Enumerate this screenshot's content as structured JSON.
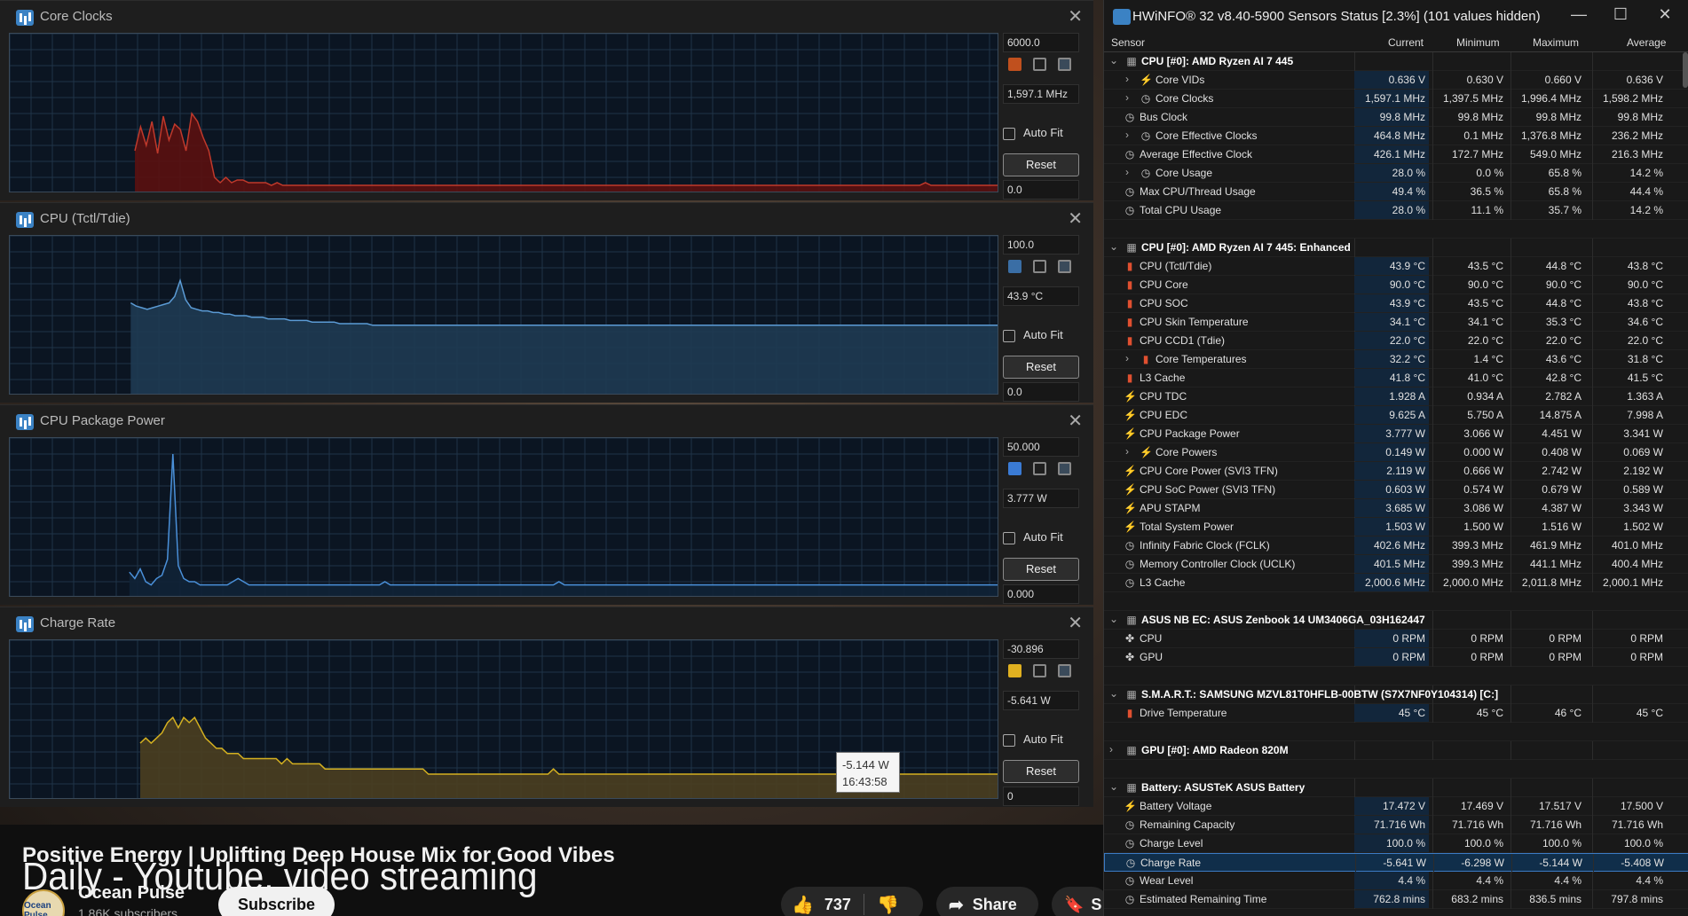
{
  "youtube": {
    "title_line1": "Positive Energy | Uplifting Deep House Mix for Good Vibes",
    "title_overlay": "Daily - Youtube, video streaming",
    "channel": "Ocean Pulse",
    "subscribers": "1.86K subscribers",
    "avatar_text": "Ocean Pulse",
    "subscribe_label": "Subscribe",
    "likes": "737",
    "share_label": "Share",
    "save_label": "S"
  },
  "graphs": [
    {
      "title": "Core Clocks",
      "max": "6000.0",
      "current": "1,597.1 MHz",
      "min": "0.0",
      "autofit": "Auto Fit",
      "reset": "Reset",
      "color": "#c0392b",
      "fill": "#5a1010",
      "swatch": "#c0501e",
      "series": [
        0,
        0,
        0,
        0,
        0,
        0,
        0,
        0,
        0,
        0,
        0,
        0,
        0,
        0,
        0,
        0,
        0,
        0,
        0,
        0,
        0,
        0,
        1600,
        2500,
        1800,
        2700,
        1500,
        2900,
        2000,
        2600,
        2400,
        1600,
        3000,
        2700,
        2100,
        1600,
        600,
        400,
        600,
        400,
        500,
        500,
        400,
        400,
        400,
        400,
        300,
        400,
        300,
        300,
        300,
        300,
        300,
        300,
        300,
        300,
        300,
        300,
        300,
        300,
        300,
        300,
        300,
        300,
        300,
        300,
        300,
        300,
        300,
        300,
        300,
        300,
        300,
        300,
        300,
        300,
        300,
        300,
        300,
        300,
        300,
        300,
        300,
        300,
        300,
        300,
        300,
        300,
        300,
        300,
        300,
        300,
        300,
        300,
        300,
        300,
        300,
        300,
        300,
        300,
        300,
        300,
        300,
        300,
        300,
        300,
        300,
        300,
        300,
        300,
        300,
        300,
        300,
        300,
        300,
        300,
        300,
        300,
        300,
        300,
        300,
        300,
        300,
        300,
        300,
        300,
        300,
        300,
        300,
        300,
        300,
        300,
        300,
        300,
        300,
        300,
        300,
        300,
        300,
        300,
        300,
        300,
        300,
        300,
        300,
        300,
        300,
        300,
        300,
        300,
        300,
        300,
        300,
        300,
        300,
        300,
        300,
        300,
        300,
        300,
        300,
        400,
        300,
        300,
        300,
        300,
        300,
        300,
        300,
        300,
        300,
        300,
        300,
        300,
        300
      ]
    },
    {
      "title": "CPU (Tctl/Tdie)",
      "max": "100.0",
      "current": "43.9 °C",
      "min": "0.0",
      "autofit": "Auto Fit",
      "reset": "Reset",
      "color": "#5b9bd5",
      "fill": "#1e3a52",
      "swatch": "#3a6ea5",
      "series": [
        0,
        0,
        0,
        0,
        0,
        0,
        0,
        0,
        0,
        0,
        0,
        0,
        0,
        0,
        0,
        0,
        0,
        0,
        0,
        0,
        0,
        0,
        58,
        56,
        55,
        54,
        55,
        56,
        57,
        58,
        62,
        72,
        60,
        55,
        54,
        53,
        53,
        52,
        52,
        51,
        51,
        50,
        50,
        50,
        49,
        49,
        49,
        48,
        48,
        48,
        48,
        47,
        47,
        47,
        47,
        46,
        46,
        46,
        46,
        46,
        45,
        45,
        45,
        45,
        45,
        45,
        44,
        44,
        44,
        44,
        44,
        44,
        44,
        44,
        44,
        44,
        44,
        44,
        44,
        44,
        44,
        44,
        44,
        44,
        44,
        44,
        44,
        44,
        44,
        44,
        44,
        44,
        44,
        44,
        44,
        44,
        44,
        44,
        44,
        44,
        44,
        44,
        44,
        44,
        44,
        44,
        44,
        44,
        44,
        44,
        44,
        44,
        44,
        44,
        44,
        44,
        44,
        44,
        44,
        44,
        44,
        44,
        44,
        44,
        44,
        44,
        44,
        44,
        44,
        44,
        44,
        44,
        44,
        44,
        44,
        44,
        44,
        44,
        44,
        44,
        44,
        44,
        44,
        44,
        44,
        44,
        44,
        44,
        44,
        44,
        44,
        44,
        44,
        44,
        44,
        44,
        44,
        44,
        44,
        44,
        44,
        44,
        44,
        44,
        44,
        44,
        44,
        44,
        44,
        44,
        44,
        44,
        44,
        44,
        44,
        44,
        44,
        44,
        44,
        44,
        44
      ]
    },
    {
      "title": "CPU Package Power",
      "max": "50.000",
      "current": "3.777 W",
      "min": "0.000",
      "autofit": "Auto Fit",
      "reset": "Reset",
      "color": "#4a90d9",
      "fill": "#0f2236",
      "swatch": "#3a7bd5",
      "series": [
        0,
        0,
        0,
        0,
        0,
        0,
        0,
        0,
        0,
        0,
        0,
        0,
        0,
        0,
        0,
        0,
        0,
        0,
        0,
        0,
        0,
        0,
        8,
        6,
        9,
        5,
        4,
        6,
        7,
        12,
        45,
        10,
        6,
        5,
        5,
        4,
        4,
        4,
        4,
        4,
        4,
        5,
        6,
        5,
        4,
        4,
        4,
        4,
        4,
        4,
        4,
        4,
        4,
        4,
        4,
        4,
        4,
        4,
        4,
        4,
        4,
        4,
        4,
        4,
        4,
        4,
        4,
        4,
        4,
        5,
        4,
        4,
        4,
        4,
        4,
        4,
        4,
        4,
        4,
        4,
        4,
        4,
        4,
        4,
        4,
        4,
        4,
        4,
        4,
        4,
        4,
        4,
        4,
        4,
        4,
        4,
        4,
        4,
        4,
        4,
        4,
        5,
        4,
        4,
        4,
        4,
        4,
        4,
        4,
        4,
        4,
        4,
        4,
        4,
        4,
        4,
        4,
        4,
        4,
        4,
        4,
        4,
        4,
        4,
        4,
        4,
        4,
        4,
        4,
        4,
        4,
        4,
        4,
        4,
        4,
        4,
        4,
        4,
        4,
        4,
        4,
        4,
        4,
        4,
        4,
        4,
        4,
        4,
        4,
        4,
        4,
        4,
        4,
        4,
        4,
        4,
        4,
        4,
        4,
        4,
        4,
        4,
        4,
        4,
        4,
        4,
        4,
        4,
        4,
        4,
        4,
        4,
        4,
        4,
        4,
        4,
        4,
        4,
        4,
        4,
        4,
        4,
        4
      ]
    },
    {
      "title": "Charge Rate",
      "max": "-30.896",
      "current": "-5.641 W",
      "min": "0",
      "autofit": "Auto Fit",
      "reset": "Reset",
      "color": "#d4b020",
      "fill": "#4a3e20",
      "swatch": "#e0b020",
      "series": [
        0,
        0,
        0,
        0,
        0,
        0,
        0,
        0,
        0,
        0,
        0,
        0,
        0,
        0,
        0,
        0,
        0,
        0,
        0,
        0,
        0,
        0,
        0,
        0,
        11,
        12,
        11,
        12,
        13,
        15,
        16,
        14,
        16,
        15,
        16,
        14,
        12,
        11,
        10,
        10,
        9,
        9,
        9,
        8,
        8,
        8,
        8,
        8,
        8,
        8,
        7,
        8,
        7,
        7,
        7,
        7,
        7,
        7,
        6,
        6,
        6,
        6,
        6,
        6,
        6,
        6,
        6,
        6,
        6,
        6,
        6,
        6,
        6,
        6,
        6,
        6,
        6,
        5,
        5,
        5,
        5,
        5,
        5,
        5,
        5,
        5,
        5,
        5,
        5,
        5,
        5,
        5,
        5,
        5,
        5,
        5,
        5,
        5,
        5,
        5,
        6,
        5,
        5,
        5,
        5,
        5,
        5,
        5,
        5,
        5,
        5,
        5,
        5,
        5,
        5,
        5,
        5,
        5,
        5,
        5,
        5,
        5,
        5,
        5,
        5,
        5,
        5,
        5,
        5,
        5,
        5,
        5,
        5,
        5,
        5,
        5,
        5,
        5,
        5,
        5,
        5,
        5,
        5,
        5,
        5,
        5,
        5,
        5,
        5,
        5,
        5,
        5,
        5,
        5,
        5,
        5,
        5,
        5,
        5,
        5,
        5,
        5,
        5,
        5,
        5,
        5,
        5,
        5,
        5,
        5,
        5,
        5,
        5,
        5,
        5,
        5,
        5,
        5,
        5,
        5,
        5,
        5,
        5
      ]
    }
  ],
  "tooltip": {
    "value": "-5.144 W",
    "time": "16:43:58"
  },
  "hwinfo": {
    "title": "HWiNFO® 32 v8.40-5900 Sensors Status [2.3%] (101 values hidden)",
    "controls": {
      "minimize": "—",
      "maximize": "☐",
      "close": "✕"
    },
    "headers": [
      "Sensor",
      "Current",
      "Minimum",
      "Maximum",
      "Average"
    ],
    "rows": [
      {
        "type": "sec",
        "name": "CPU [#0]: AMD Ryzen AI 7 445"
      },
      {
        "name": "Core VIDs",
        "icon": "bolt",
        "sub": true,
        "cur": "0.636 V",
        "min": "0.630 V",
        "max": "0.660 V",
        "avg": "0.636 V"
      },
      {
        "name": "Core Clocks",
        "icon": "clock",
        "sub": true,
        "cur": "1,597.1 MHz",
        "min": "1,397.5 MHz",
        "max": "1,996.4 MHz",
        "avg": "1,598.2 MHz"
      },
      {
        "name": "Bus Clock",
        "icon": "clock",
        "cur": "99.8 MHz",
        "min": "99.8 MHz",
        "max": "99.8 MHz",
        "avg": "99.8 MHz"
      },
      {
        "name": "Core Effective Clocks",
        "icon": "clock",
        "sub": true,
        "cur": "464.8 MHz",
        "min": "0.1 MHz",
        "max": "1,376.8 MHz",
        "avg": "236.2 MHz"
      },
      {
        "name": "Average Effective Clock",
        "icon": "clock",
        "cur": "426.1 MHz",
        "min": "172.7 MHz",
        "max": "549.0 MHz",
        "avg": "216.3 MHz"
      },
      {
        "name": "Core Usage",
        "icon": "clock",
        "sub": true,
        "cur": "28.0 %",
        "min": "0.0 %",
        "max": "65.8 %",
        "avg": "14.2 %"
      },
      {
        "name": "Max CPU/Thread Usage",
        "icon": "clock",
        "cur": "49.4 %",
        "min": "36.5 %",
        "max": "65.8 %",
        "avg": "44.4 %"
      },
      {
        "name": "Total CPU Usage",
        "icon": "clock",
        "cur": "28.0 %",
        "min": "11.1 %",
        "max": "35.7 %",
        "avg": "14.2 %"
      },
      {
        "type": "blank"
      },
      {
        "type": "sec",
        "name": "CPU [#0]: AMD Ryzen AI 7 445: Enhanced"
      },
      {
        "name": "CPU (Tctl/Tdie)",
        "icon": "temp",
        "cur": "43.9 °C",
        "min": "43.5 °C",
        "max": "44.8 °C",
        "avg": "43.8 °C"
      },
      {
        "name": "CPU Core",
        "icon": "temp",
        "cur": "90.0 °C",
        "min": "90.0 °C",
        "max": "90.0 °C",
        "avg": "90.0 °C"
      },
      {
        "name": "CPU SOC",
        "icon": "temp",
        "cur": "43.9 °C",
        "min": "43.5 °C",
        "max": "44.8 °C",
        "avg": "43.8 °C"
      },
      {
        "name": "CPU Skin Temperature",
        "icon": "temp",
        "cur": "34.1 °C",
        "min": "34.1 °C",
        "max": "35.3 °C",
        "avg": "34.6 °C"
      },
      {
        "name": "CPU CCD1 (Tdie)",
        "icon": "temp",
        "cur": "22.0 °C",
        "min": "22.0 °C",
        "max": "22.0 °C",
        "avg": "22.0 °C"
      },
      {
        "name": "Core Temperatures",
        "icon": "temp",
        "sub": true,
        "cur": "32.2 °C",
        "min": "1.4 °C",
        "max": "43.6 °C",
        "avg": "31.8 °C"
      },
      {
        "name": "L3 Cache",
        "icon": "temp",
        "cur": "41.8 °C",
        "min": "41.0 °C",
        "max": "42.8 °C",
        "avg": "41.5 °C"
      },
      {
        "name": "CPU TDC",
        "icon": "bolt",
        "cur": "1.928 A",
        "min": "0.934 A",
        "max": "2.782 A",
        "avg": "1.363 A"
      },
      {
        "name": "CPU EDC",
        "icon": "bolt",
        "cur": "9.625 A",
        "min": "5.750 A",
        "max": "14.875 A",
        "avg": "7.998 A"
      },
      {
        "name": "CPU Package Power",
        "icon": "bolt",
        "cur": "3.777 W",
        "min": "3.066 W",
        "max": "4.451 W",
        "avg": "3.341 W"
      },
      {
        "name": "Core Powers",
        "icon": "bolt",
        "sub": true,
        "cur": "0.149 W",
        "min": "0.000 W",
        "max": "0.408 W",
        "avg": "0.069 W"
      },
      {
        "name": "CPU Core Power (SVI3 TFN)",
        "icon": "bolt",
        "cur": "2.119 W",
        "min": "0.666 W",
        "max": "2.742 W",
        "avg": "2.192 W"
      },
      {
        "name": "CPU SoC Power (SVI3 TFN)",
        "icon": "bolt",
        "cur": "0.603 W",
        "min": "0.574 W",
        "max": "0.679 W",
        "avg": "0.589 W"
      },
      {
        "name": "APU STAPM",
        "icon": "bolt",
        "cur": "3.685 W",
        "min": "3.086 W",
        "max": "4.387 W",
        "avg": "3.343 W"
      },
      {
        "name": "Total System Power",
        "icon": "bolt",
        "cur": "1.503 W",
        "min": "1.500 W",
        "max": "1.516 W",
        "avg": "1.502 W"
      },
      {
        "name": "Infinity Fabric Clock (FCLK)",
        "icon": "clock",
        "cur": "402.6 MHz",
        "min": "399.3 MHz",
        "max": "461.9 MHz",
        "avg": "401.0 MHz"
      },
      {
        "name": "Memory Controller Clock (UCLK)",
        "icon": "clock",
        "cur": "401.5 MHz",
        "min": "399.3 MHz",
        "max": "441.1 MHz",
        "avg": "400.4 MHz"
      },
      {
        "name": "L3 Cache",
        "icon": "clock",
        "cur": "2,000.6 MHz",
        "min": "2,000.0 MHz",
        "max": "2,011.8 MHz",
        "avg": "2,000.1 MHz"
      },
      {
        "type": "blank"
      },
      {
        "type": "sec",
        "name": "ASUS NB EC: ASUS Zenbook 14 UM3406GA_03H162447"
      },
      {
        "name": "CPU",
        "icon": "fan",
        "cur": "0 RPM",
        "min": "0 RPM",
        "max": "0 RPM",
        "avg": "0 RPM"
      },
      {
        "name": "GPU",
        "icon": "fan",
        "cur": "0 RPM",
        "min": "0 RPM",
        "max": "0 RPM",
        "avg": "0 RPM"
      },
      {
        "type": "blank"
      },
      {
        "type": "sec",
        "name": "S.M.A.R.T.: SAMSUNG MZVL81T0HFLB-00BTW (S7X7NF0Y104314) [C:]"
      },
      {
        "name": "Drive Temperature",
        "icon": "temp",
        "cur": "45 °C",
        "min": "45 °C",
        "max": "46 °C",
        "avg": "45 °C"
      },
      {
        "type": "blank"
      },
      {
        "type": "sec",
        "collapsed": true,
        "name": "GPU [#0]: AMD Radeon 820M"
      },
      {
        "type": "blank"
      },
      {
        "type": "sec",
        "name": "Battery: ASUSTeK ASUS Battery"
      },
      {
        "name": "Battery Voltage",
        "icon": "bolt",
        "cur": "17.472 V",
        "min": "17.469 V",
        "max": "17.517 V",
        "avg": "17.500 V"
      },
      {
        "name": "Remaining Capacity",
        "icon": "clock",
        "cur": "71.716 Wh",
        "min": "71.716 Wh",
        "max": "71.716 Wh",
        "avg": "71.716 Wh"
      },
      {
        "name": "Charge Level",
        "icon": "clock",
        "cur": "100.0 %",
        "min": "100.0 %",
        "max": "100.0 %",
        "avg": "100.0 %"
      },
      {
        "name": "Charge Rate",
        "icon": "clock",
        "sel": true,
        "cur": "-5.641 W",
        "min": "-6.298 W",
        "max": "-5.144 W",
        "avg": "-5.408 W"
      },
      {
        "name": "Wear Level",
        "icon": "clock",
        "cur": "4.4 %",
        "min": "4.4 %",
        "max": "4.4 %",
        "avg": "4.4 %"
      },
      {
        "name": "Estimated Remaining Time",
        "icon": "clock",
        "cur": "762.8 mins",
        "min": "683.2 mins",
        "max": "836.5 mins",
        "avg": "797.8 mins"
      }
    ]
  },
  "icons": {
    "bolt": "⚡",
    "clock": "◷",
    "temp": "▮",
    "fan": "✤",
    "expand": "›",
    "collapse": "⌄",
    "close": "✕"
  }
}
